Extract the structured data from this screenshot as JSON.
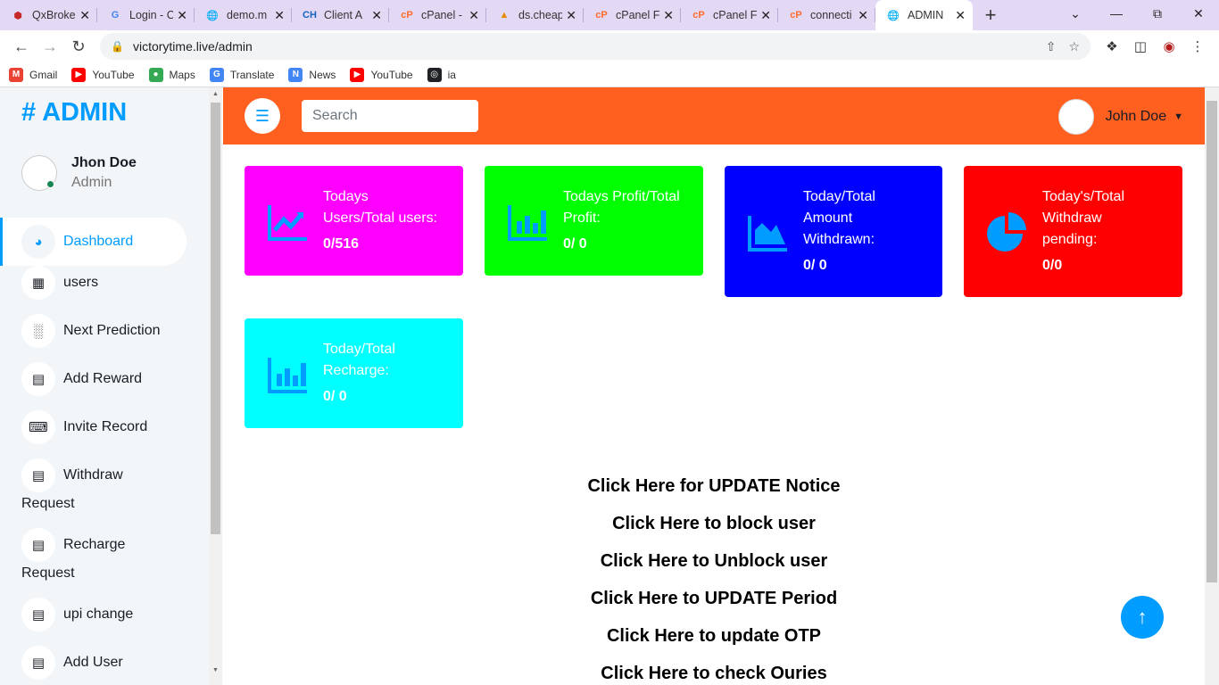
{
  "browser": {
    "tabs": [
      {
        "title": "QxBroke",
        "favicon": "ruby-icon",
        "color": "#c62828"
      },
      {
        "title": "Login - C",
        "favicon": "google-icon",
        "color": "#4285f4"
      },
      {
        "title": "demo.m",
        "favicon": "globe-icon",
        "color": "#555555"
      },
      {
        "title": "Client A",
        "favicon": "ch-icon",
        "color": "#1565c0"
      },
      {
        "title": "cPanel -",
        "favicon": "cpanel-icon",
        "color": "#ff6c2c"
      },
      {
        "title": "ds.cheap",
        "favicon": "pma-icon",
        "color": "#e68a00"
      },
      {
        "title": "cPanel F",
        "favicon": "cpanel-icon",
        "color": "#ff6c2c"
      },
      {
        "title": "cPanel F",
        "favicon": "cpanel-icon",
        "color": "#ff6c2c"
      },
      {
        "title": "connecti",
        "favicon": "cpanel-icon",
        "color": "#ff6c2c"
      },
      {
        "title": "ADMIN",
        "favicon": "globe-icon",
        "color": "#555555",
        "active": true
      }
    ],
    "url": "victorytime.live/admin",
    "bookmarks": [
      {
        "label": "Gmail",
        "icon": "gmail-icon",
        "color": "#ea4335"
      },
      {
        "label": "YouTube",
        "icon": "youtube-icon",
        "color": "#ff0000"
      },
      {
        "label": "Maps",
        "icon": "maps-icon",
        "color": "#34a853"
      },
      {
        "label": "Translate",
        "icon": "translate-icon",
        "color": "#4285f4"
      },
      {
        "label": "News",
        "icon": "news-icon",
        "color": "#4285f4"
      },
      {
        "label": "YouTube",
        "icon": "youtube-icon",
        "color": "#ff0000"
      },
      {
        "label": "ia",
        "icon": "globe-icon",
        "color": "#202124"
      }
    ]
  },
  "sidebar": {
    "brand": "# ADMIN",
    "profile": {
      "name": "Jhon Doe",
      "role": "Admin"
    },
    "items": [
      {
        "label": "Dashboard",
        "icon": "tachometer-icon",
        "active": true
      },
      {
        "label": "users",
        "icon": "grid-icon"
      },
      {
        "label": "Next Prediction",
        "icon": "bar-chart-icon"
      },
      {
        "label": "Add Reward",
        "icon": "table-icon"
      },
      {
        "label": "Invite Record",
        "icon": "keyboard-icon"
      },
      {
        "label": "Withdraw",
        "label2": "Request",
        "icon": "table-icon"
      },
      {
        "label": "Recharge",
        "label2": "Request",
        "icon": "table-icon"
      },
      {
        "label": "upi change",
        "icon": "table-icon"
      },
      {
        "label": "Add User",
        "icon": "table-icon"
      }
    ]
  },
  "topbar": {
    "search_placeholder": "Search",
    "user_name": "John Doe"
  },
  "cards": [
    {
      "title": "Todays Users/Total users:",
      "value": "0/516",
      "icon": "chart-line-icon",
      "bg": "#ff00ff"
    },
    {
      "title": "Todays Profit/Total Profit:",
      "value": "0/ 0",
      "icon": "chart-bar-icon",
      "bg": "#00ff00"
    },
    {
      "title": "Today/Total Amount Withdrawn:",
      "value": "0/ 0",
      "icon": "chart-area-icon",
      "bg": "#0000ff"
    },
    {
      "title": "Today's/Total Withdraw pending:",
      "value": "0/0",
      "icon": "chart-pie-icon",
      "bg": "#ff0000"
    },
    {
      "title": "Today/Total Recharge:",
      "value": "0/ 0",
      "icon": "chart-bar-icon",
      "bg": "#00ffff"
    }
  ],
  "links": [
    "Click Here for UPDATE Notice",
    "Click Here to block user",
    "Click Here to Unblock user",
    "Click Here to UPDATE Period",
    "Click Here to update OTP",
    "Click Here to check Ouries"
  ],
  "colors": {
    "accent": "#009cff",
    "topbar": "#ff5f1f",
    "sidebar": "#f3f6f9"
  }
}
